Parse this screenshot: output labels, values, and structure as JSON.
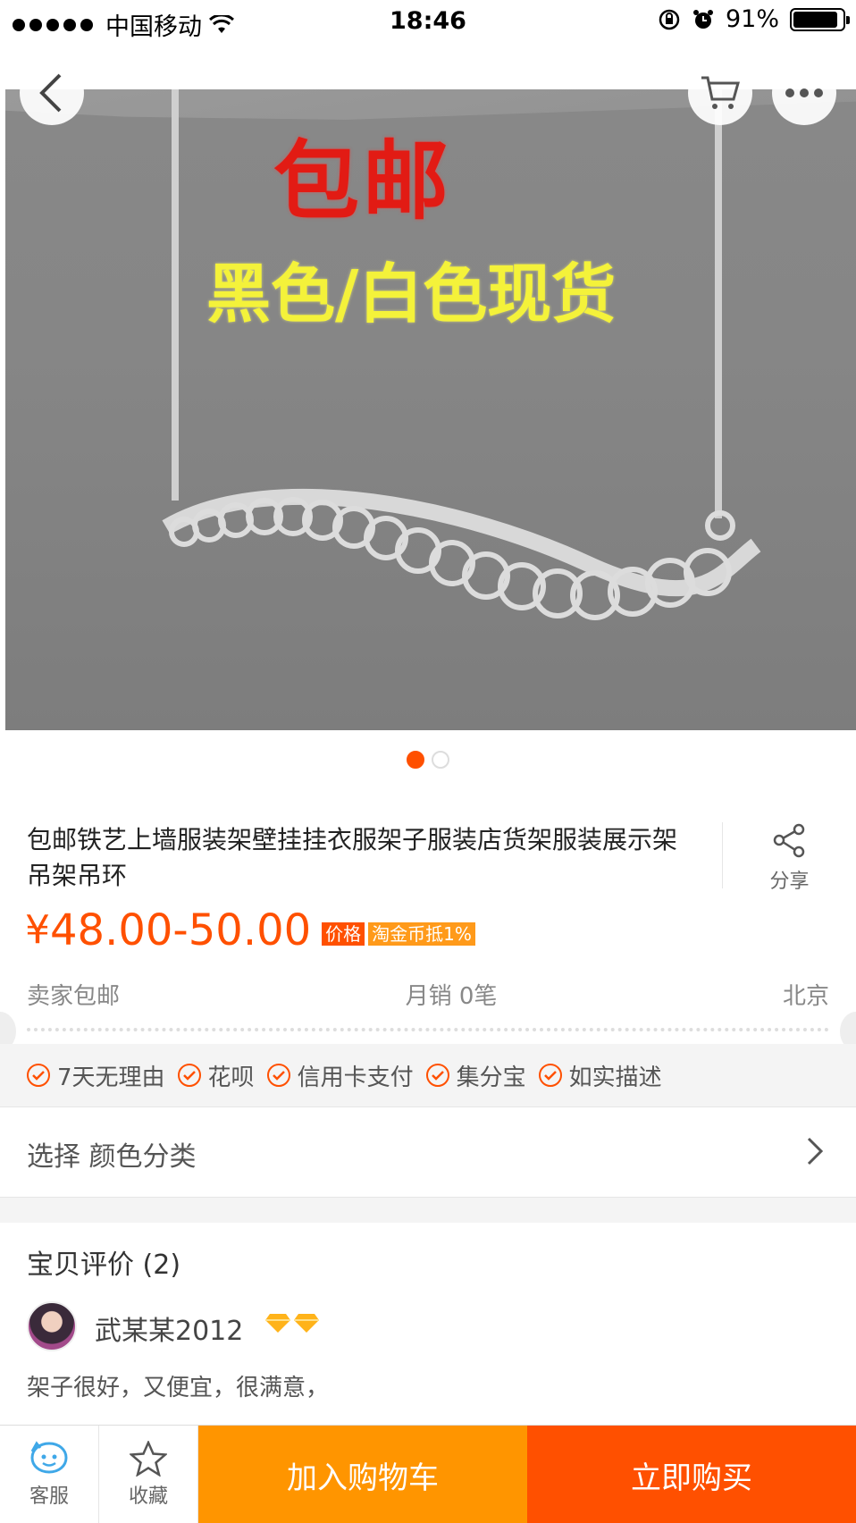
{
  "status_bar": {
    "carrier": "中国移动",
    "time": "18:46",
    "battery": "91%"
  },
  "gallery": {
    "overlay_red": "包邮",
    "overlay_yellow": "黑色/白色现货",
    "page_count": 2,
    "active_page": 1
  },
  "product": {
    "title": "包邮铁艺上墙服装架壁挂挂衣服架子服装店货架服装展示架吊架吊环",
    "share_label": "分享",
    "price_currency": "¥",
    "price_range": "48.00-50.00",
    "tag_price": "价格",
    "tag_coin": "淘金币抵1%",
    "shipping": "卖家包邮",
    "monthly_sales": "月销 0笔",
    "location": "北京"
  },
  "services": [
    "7天无理由",
    "花呗",
    "信用卡支付",
    "集分宝",
    "如实描述"
  ],
  "select_option": "选择 颜色分类",
  "reviews": {
    "title": "宝贝评价 (2)",
    "username": "武某某2012",
    "text": "架子很好，又便宜，很满意，"
  },
  "bottom_bar": {
    "service_label": "客服",
    "favorite_label": "收藏",
    "add_to_cart": "加入购物车",
    "buy_now": "立即购买"
  },
  "colors": {
    "accent": "#ff5000",
    "cart_orange": "#ff9500"
  }
}
